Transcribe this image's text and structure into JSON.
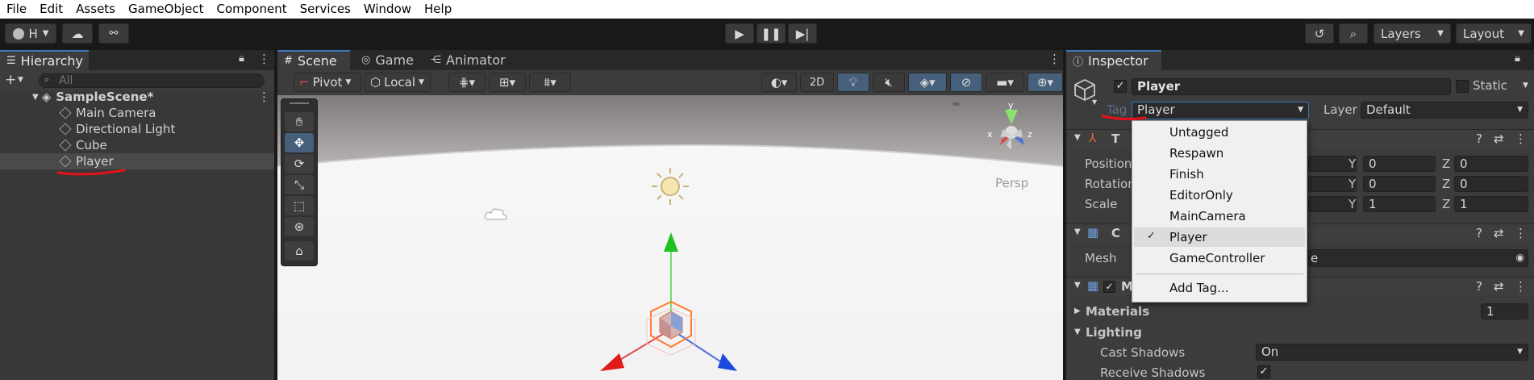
{
  "menu": [
    "File",
    "Edit",
    "Assets",
    "GameObject",
    "Component",
    "Services",
    "Window",
    "Help"
  ],
  "toolbar": {
    "account": "H",
    "layers": "Layers",
    "layout": "Layout"
  },
  "hierarchy": {
    "title": "Hierarchy",
    "search_placeholder": "All",
    "scene": "SampleScene*",
    "items": [
      "Main Camera",
      "Directional Light",
      "Cube",
      "Player"
    ]
  },
  "scene_tabs": {
    "scene": "Scene",
    "game": "Game",
    "animator": "Animator"
  },
  "scene_toolbar": {
    "pivot": "Pivot",
    "local": "Local",
    "mode2d": "2D",
    "persp": "Persp",
    "gizmo_y": "y",
    "gizmo_x": "x",
    "gizmo_z": "z"
  },
  "inspector": {
    "title": "Inspector",
    "object_name": "Player",
    "static_label": "Static",
    "tag_label": "Tag",
    "tag_value": "Player",
    "layer_label": "Layer",
    "layer_value": "Default",
    "transform": {
      "title": "T",
      "position": "Position",
      "rotation": "Rotation",
      "scale": "Scale",
      "axis_y": "Y",
      "axis_z": "Z",
      "pos_y": "0",
      "pos_z": "0",
      "rot_y": "0",
      "rot_z": "0",
      "scl_y": "1",
      "scl_z": "1"
    },
    "meshfilter": {
      "title": "C",
      "mesh_label": "Mesh",
      "mesh_value": "e"
    },
    "meshrenderer": {
      "title": "M",
      "materials": "Materials",
      "materials_count": "1",
      "lighting": "Lighting",
      "cast_shadows": "Cast Shadows",
      "cast_value": "On",
      "receive_shadows": "Receive Shadows"
    }
  },
  "tag_dropdown": {
    "items": [
      "Untagged",
      "Respawn",
      "Finish",
      "EditorOnly",
      "MainCamera",
      "Player",
      "GameController"
    ],
    "selected": "Player",
    "add": "Add Tag..."
  },
  "colors": {
    "accent": "#3a79bb",
    "annotation": "#e8101a"
  }
}
